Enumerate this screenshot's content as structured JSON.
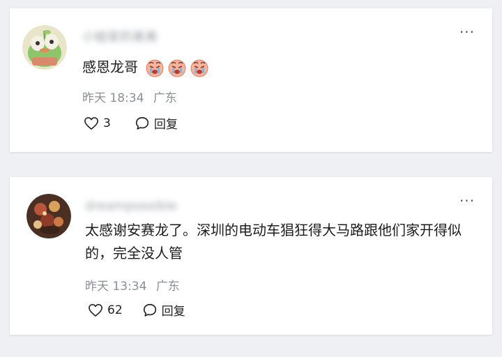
{
  "comments": [
    {
      "username": "小蛙家的美美",
      "text": "感恩龙哥",
      "emoji_count": 3,
      "emoji_icon": "crying-face-icon",
      "time": "昨天 18:34",
      "location": "广东",
      "likes": "3",
      "reply_label": "回复"
    },
    {
      "username": "dreampossible",
      "text": "太感谢安赛龙了。深圳的电动车猖狂得大马路跟他们家开得似的，完全没人管",
      "time": "昨天 13:34",
      "location": "广东",
      "likes": "62",
      "reply_label": "回复"
    }
  ],
  "more_label": "···",
  "colors": {
    "background": "#eef0f3",
    "card": "#ffffff",
    "meta_text": "#8a8f96",
    "main_text": "#1c1c1c"
  }
}
